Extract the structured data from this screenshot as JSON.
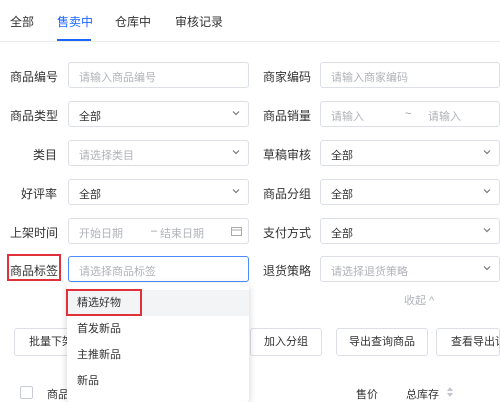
{
  "tabs": [
    {
      "label": "全部"
    },
    {
      "label": "售卖中"
    },
    {
      "label": "仓库中"
    },
    {
      "label": "审核记录"
    }
  ],
  "form": {
    "product_code": {
      "label": "商品编号",
      "placeholder": "请输入商品编号"
    },
    "merchant_code": {
      "label": "商家编码",
      "placeholder": "请输入商家编码"
    },
    "product_type": {
      "label": "商品类型",
      "value": "全部"
    },
    "sales": {
      "label": "商品销量",
      "min_placeholder": "请输入",
      "sep": "~",
      "max_placeholder": "请输入"
    },
    "category": {
      "label": "类目",
      "placeholder": "请选择类目"
    },
    "draft_review": {
      "label": "草稿审核",
      "value": "全部"
    },
    "rating": {
      "label": "好评率",
      "value": "全部"
    },
    "group": {
      "label": "商品分组",
      "value": "全部"
    },
    "listing_time": {
      "label": "上架时间",
      "start_placeholder": "开始日期",
      "sep": "–",
      "end_placeholder": "结束日期"
    },
    "payment": {
      "label": "支付方式",
      "value": "全部"
    },
    "tag": {
      "label": "商品标签",
      "placeholder": "请选择商品标签"
    },
    "return_policy": {
      "label": "退货策略",
      "placeholder": "请选择退货策略"
    }
  },
  "tag_dropdown": {
    "items": [
      "精选好物",
      "首发新品",
      "主推新品",
      "新品"
    ]
  },
  "collapse_label": "收起 ^",
  "buttons": {
    "batch": "批量下架",
    "add_group": "加入分组",
    "export_query": "导出查询商品",
    "view_export": "查看导出记录"
  },
  "table": {
    "headers": {
      "product": "商品",
      "price": "售价",
      "stock": "总库存"
    }
  },
  "colors": {
    "accent": "#1a66ff",
    "highlight": "#e0313a"
  }
}
